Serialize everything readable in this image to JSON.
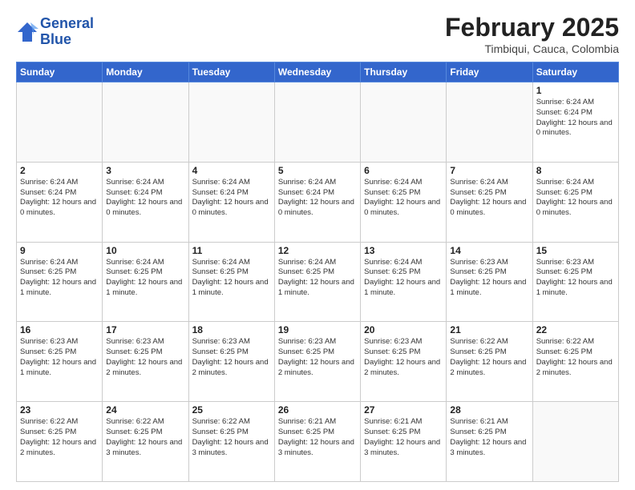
{
  "header": {
    "logo_line1": "General",
    "logo_line2": "Blue",
    "month_title": "February 2025",
    "subtitle": "Timbiqui, Cauca, Colombia"
  },
  "weekdays": [
    "Sunday",
    "Monday",
    "Tuesday",
    "Wednesday",
    "Thursday",
    "Friday",
    "Saturday"
  ],
  "weeks": [
    [
      {
        "day": "",
        "info": ""
      },
      {
        "day": "",
        "info": ""
      },
      {
        "day": "",
        "info": ""
      },
      {
        "day": "",
        "info": ""
      },
      {
        "day": "",
        "info": ""
      },
      {
        "day": "",
        "info": ""
      },
      {
        "day": "1",
        "info": "Sunrise: 6:24 AM\nSunset: 6:24 PM\nDaylight: 12 hours\nand 0 minutes."
      }
    ],
    [
      {
        "day": "2",
        "info": "Sunrise: 6:24 AM\nSunset: 6:24 PM\nDaylight: 12 hours\nand 0 minutes."
      },
      {
        "day": "3",
        "info": "Sunrise: 6:24 AM\nSunset: 6:24 PM\nDaylight: 12 hours\nand 0 minutes."
      },
      {
        "day": "4",
        "info": "Sunrise: 6:24 AM\nSunset: 6:24 PM\nDaylight: 12 hours\nand 0 minutes."
      },
      {
        "day": "5",
        "info": "Sunrise: 6:24 AM\nSunset: 6:24 PM\nDaylight: 12 hours\nand 0 minutes."
      },
      {
        "day": "6",
        "info": "Sunrise: 6:24 AM\nSunset: 6:25 PM\nDaylight: 12 hours\nand 0 minutes."
      },
      {
        "day": "7",
        "info": "Sunrise: 6:24 AM\nSunset: 6:25 PM\nDaylight: 12 hours\nand 0 minutes."
      },
      {
        "day": "8",
        "info": "Sunrise: 6:24 AM\nSunset: 6:25 PM\nDaylight: 12 hours\nand 0 minutes."
      }
    ],
    [
      {
        "day": "9",
        "info": "Sunrise: 6:24 AM\nSunset: 6:25 PM\nDaylight: 12 hours\nand 1 minute."
      },
      {
        "day": "10",
        "info": "Sunrise: 6:24 AM\nSunset: 6:25 PM\nDaylight: 12 hours\nand 1 minute."
      },
      {
        "day": "11",
        "info": "Sunrise: 6:24 AM\nSunset: 6:25 PM\nDaylight: 12 hours\nand 1 minute."
      },
      {
        "day": "12",
        "info": "Sunrise: 6:24 AM\nSunset: 6:25 PM\nDaylight: 12 hours\nand 1 minute."
      },
      {
        "day": "13",
        "info": "Sunrise: 6:24 AM\nSunset: 6:25 PM\nDaylight: 12 hours\nand 1 minute."
      },
      {
        "day": "14",
        "info": "Sunrise: 6:23 AM\nSunset: 6:25 PM\nDaylight: 12 hours\nand 1 minute."
      },
      {
        "day": "15",
        "info": "Sunrise: 6:23 AM\nSunset: 6:25 PM\nDaylight: 12 hours\nand 1 minute."
      }
    ],
    [
      {
        "day": "16",
        "info": "Sunrise: 6:23 AM\nSunset: 6:25 PM\nDaylight: 12 hours\nand 1 minute."
      },
      {
        "day": "17",
        "info": "Sunrise: 6:23 AM\nSunset: 6:25 PM\nDaylight: 12 hours\nand 2 minutes."
      },
      {
        "day": "18",
        "info": "Sunrise: 6:23 AM\nSunset: 6:25 PM\nDaylight: 12 hours\nand 2 minutes."
      },
      {
        "day": "19",
        "info": "Sunrise: 6:23 AM\nSunset: 6:25 PM\nDaylight: 12 hours\nand 2 minutes."
      },
      {
        "day": "20",
        "info": "Sunrise: 6:23 AM\nSunset: 6:25 PM\nDaylight: 12 hours\nand 2 minutes."
      },
      {
        "day": "21",
        "info": "Sunrise: 6:22 AM\nSunset: 6:25 PM\nDaylight: 12 hours\nand 2 minutes."
      },
      {
        "day": "22",
        "info": "Sunrise: 6:22 AM\nSunset: 6:25 PM\nDaylight: 12 hours\nand 2 minutes."
      }
    ],
    [
      {
        "day": "23",
        "info": "Sunrise: 6:22 AM\nSunset: 6:25 PM\nDaylight: 12 hours\nand 2 minutes."
      },
      {
        "day": "24",
        "info": "Sunrise: 6:22 AM\nSunset: 6:25 PM\nDaylight: 12 hours\nand 3 minutes."
      },
      {
        "day": "25",
        "info": "Sunrise: 6:22 AM\nSunset: 6:25 PM\nDaylight: 12 hours\nand 3 minutes."
      },
      {
        "day": "26",
        "info": "Sunrise: 6:21 AM\nSunset: 6:25 PM\nDaylight: 12 hours\nand 3 minutes."
      },
      {
        "day": "27",
        "info": "Sunrise: 6:21 AM\nSunset: 6:25 PM\nDaylight: 12 hours\nand 3 minutes."
      },
      {
        "day": "28",
        "info": "Sunrise: 6:21 AM\nSunset: 6:25 PM\nDaylight: 12 hours\nand 3 minutes."
      },
      {
        "day": "",
        "info": ""
      }
    ]
  ]
}
